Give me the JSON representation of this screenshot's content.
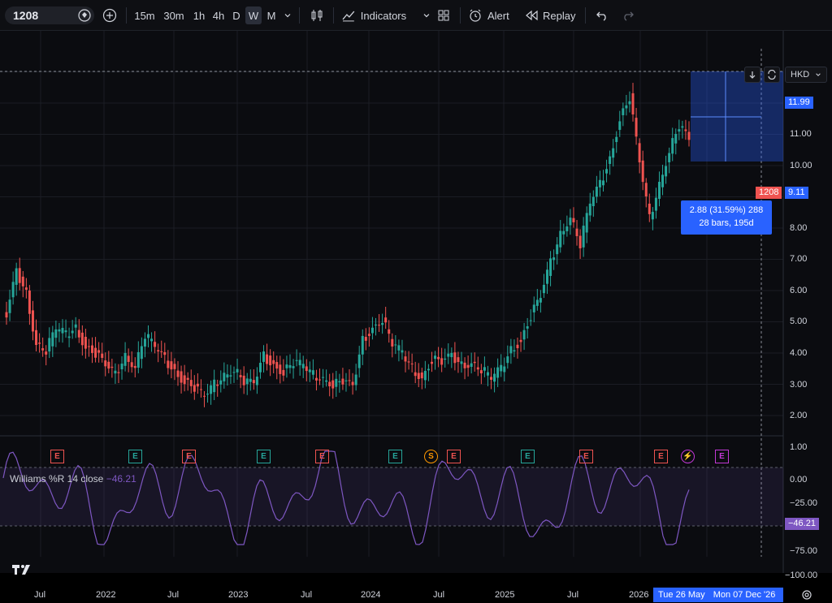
{
  "toolbar": {
    "symbol": "1208",
    "intervals": [
      "15m",
      "30m",
      "1h",
      "4h",
      "D",
      "W",
      "M"
    ],
    "active_interval": "W",
    "indicators_label": "Indicators",
    "alert_label": "Alert",
    "replay_label": "Replay"
  },
  "chart_controls": {
    "currency": "HKD"
  },
  "price_axis": {
    "ticks": [
      "11.00",
      "10.00",
      "9.00",
      "8.00",
      "7.00",
      "6.00",
      "5.00",
      "4.00",
      "3.00",
      "2.00",
      "1.00"
    ],
    "high_tag": "11.99",
    "current_symbol_tag": "1208",
    "current_price_tag": "9.11"
  },
  "measure_tooltip": {
    "line1": "2.88 (31.59%) 288",
    "line2": "28 bars, 195d"
  },
  "indicator": {
    "name": "Williams %R 14 close",
    "value": "−46.21",
    "axis_ticks": [
      "0.00",
      "−25.00",
      "−75.00",
      "−100.00"
    ],
    "value_tag": "−46.21"
  },
  "time_axis": {
    "labels": [
      "Jul",
      "2022",
      "Jul",
      "2023",
      "Jul",
      "2024",
      "Jul",
      "2025",
      "Jul",
      "2026"
    ],
    "cursor_date": "Tue 26 May",
    "cursor_date2": "Mon 07 Dec '26"
  },
  "events": [
    "E",
    "E",
    "E",
    "E",
    "E",
    "E",
    "S",
    "E",
    "E",
    "E",
    "E",
    "⚡",
    "E"
  ],
  "colors": {
    "up": "#26a69a",
    "down": "#ef5350",
    "accent": "#2962ff",
    "indicator": "#7e57c2"
  },
  "chart_data": {
    "type": "line",
    "title": "",
    "series": [
      {
        "name": "",
        "values": [
          4.2,
          5.6,
          4.9,
          3.3,
          3.1,
          3.8,
          3.6,
          3.8,
          3.2,
          3.0,
          2.6,
          2.3,
          2.9,
          2.6,
          3.6,
          3.2,
          2.8,
          2.4,
          2.1,
          1.9,
          1.6,
          2.0,
          2.3,
          2.5,
          2.1,
          2.0,
          2.9,
          2.6,
          2.4,
          2.7,
          2.6,
          2.3,
          2.2,
          2.0,
          2.1,
          1.9,
          3.4,
          3.8,
          4.1,
          3.3,
          3.0,
          2.5,
          2.2,
          2.8,
          2.7,
          2.9,
          2.6,
          2.7,
          2.5,
          2.2,
          2.5,
          3.1,
          3.4,
          4.2,
          4.8,
          5.9,
          6.8,
          7.4,
          6.5,
          7.8,
          8.4,
          9.2,
          10.5,
          11.2,
          9.1,
          7.3,
          8.4,
          9.5,
          10.3,
          9.8
        ]
      }
    ],
    "ylim": [
      1,
      12
    ],
    "xlabel": "",
    "ylabel": ""
  }
}
